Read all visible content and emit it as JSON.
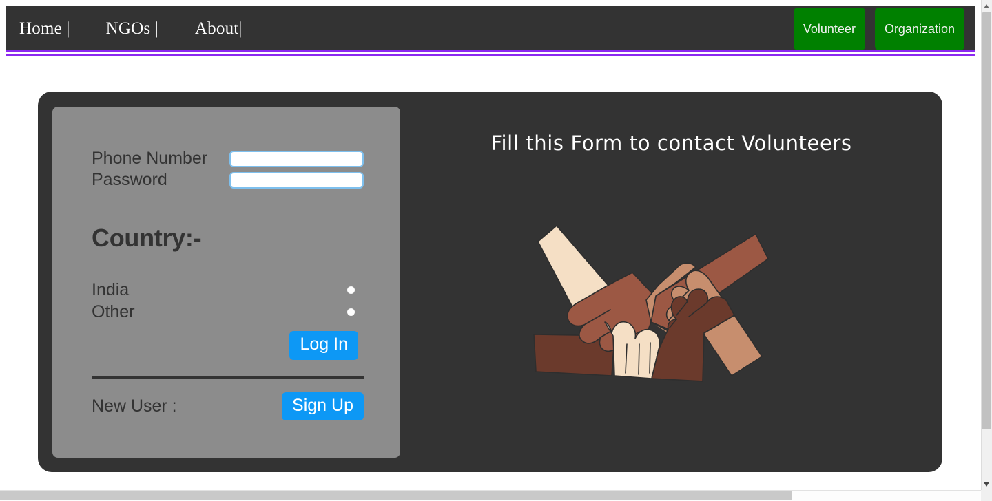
{
  "navbar": {
    "links": [
      {
        "label": "Home |",
        "name": "nav-link-home"
      },
      {
        "label": "NGOs |",
        "name": "nav-link-ngos"
      },
      {
        "label": "About|",
        "name": "nav-link-about"
      }
    ],
    "buttons": [
      {
        "label": "Volunteer"
      },
      {
        "label": "Organization"
      }
    ],
    "background_color": "#333333",
    "accent_rule_color": "#8b28f0",
    "button_color": "#008000"
  },
  "form": {
    "fields": [
      {
        "label": "Phone Number",
        "value": "",
        "placeholder": ""
      },
      {
        "label": "Password",
        "value": "",
        "placeholder": ""
      }
    ],
    "country_heading": "Country:-",
    "country_options": [
      {
        "label": "India",
        "selected": false
      },
      {
        "label": "Other",
        "selected": false
      }
    ],
    "login_button": "Log In",
    "new_user_label": "New User :",
    "signup_button": "Sign Up",
    "card_background": "#8c8c8c",
    "input_border_color": "#7ec0ee",
    "button_color": "#0d98f5"
  },
  "right_pane": {
    "heading": "Fill this Form to contact Volunteers",
    "illustration": {
      "name": "interlocking-hands-illustration",
      "description": "Four interlocking arms and hands of different skin tones forming a square",
      "colors": {
        "cream": "#f5dfc5",
        "tan": "#c78e6e",
        "medium_brown": "#9c5844",
        "dark_brown": "#6b3a2c",
        "outline": "#2e2e2e"
      }
    }
  },
  "panel": {
    "background_color": "#333333"
  },
  "scrollbars": {
    "vertical_position_percent": 0,
    "horizontal_position_percent": 0
  }
}
